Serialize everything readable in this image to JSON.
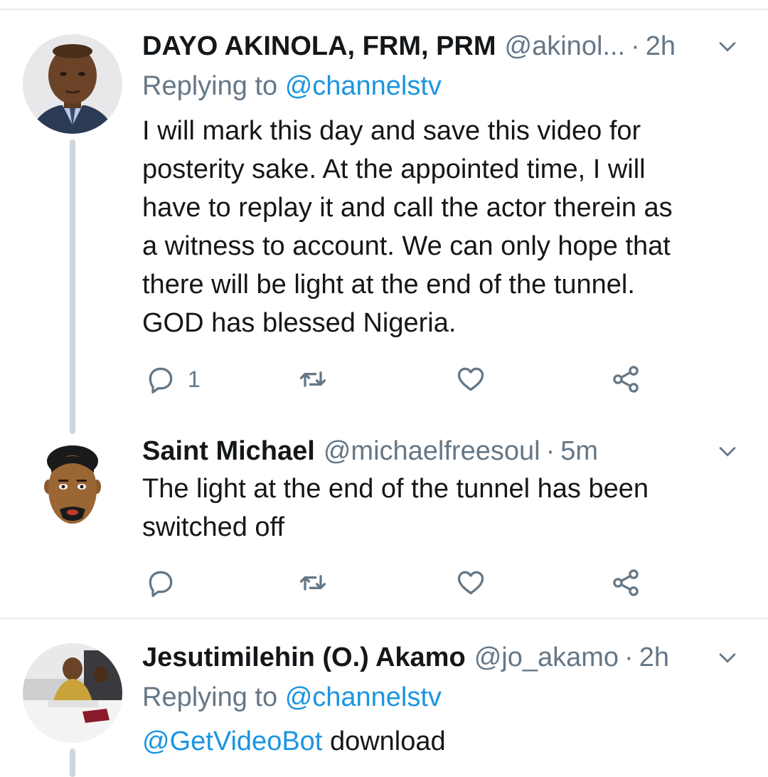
{
  "tweets": [
    {
      "name": "DAYO AKINOLA, FRM, PRM",
      "handle": "@akinol...",
      "sep": "·",
      "time": "2h",
      "replying_prefix": "Replying to",
      "replying_to": "@channelstv",
      "lines": [
        "I will mark this day and save this video for",
        "posterity sake. At the appointed time, I will",
        "have to replay it and call the actor therein as",
        "a witness to account. We can only hope that",
        "there will be light at the end of the tunnel.",
        "GOD has blessed Nigeria."
      ],
      "reply_count": "1"
    },
    {
      "name": "Saint Michael",
      "handle": "@michaelfreesoul",
      "sep": "·",
      "time": "5m",
      "lines": [
        "The light at the end of the tunnel has been",
        "switched off"
      ],
      "reply_count": ""
    },
    {
      "name": "Jesutimilehin (O.) Akamo",
      "handle": "@jo_akamo",
      "sep": "·",
      "time": "2h",
      "replying_prefix": "Replying to",
      "replying_to": "@channelstv",
      "mention": "@GetVideoBot",
      "text": "download"
    }
  ],
  "colors": {
    "accent": "#1b95e0",
    "secondary_text": "#657786",
    "thread_line": "#ccd6dd",
    "divider": "#e6ecf0"
  },
  "icons": [
    "reply-icon",
    "retweet-icon",
    "like-icon",
    "share-icon",
    "chevron-down-icon"
  ]
}
